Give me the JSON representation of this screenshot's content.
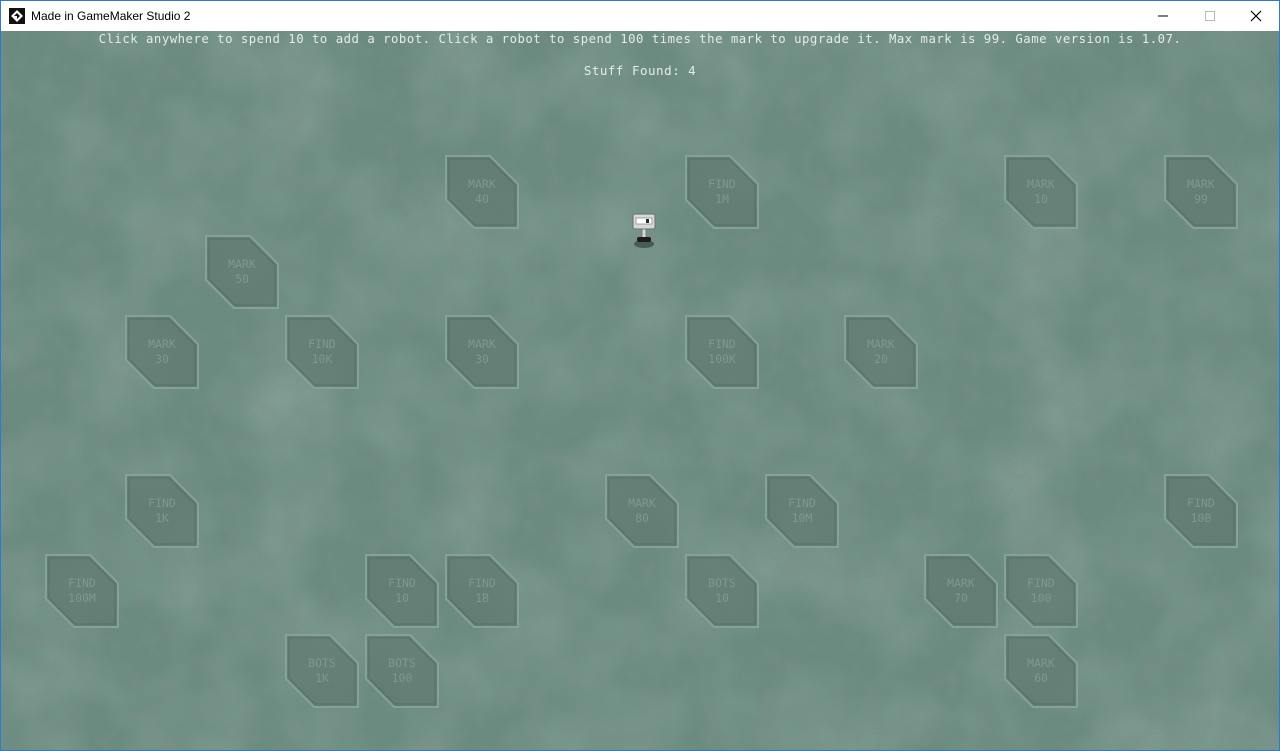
{
  "window": {
    "title": "Made in GameMaker Studio 2",
    "icon": "gamemaker-icon",
    "controls": [
      "minimize-icon",
      "maximize-icon",
      "close-icon"
    ]
  },
  "hud": {
    "instructions": "Click anywhere to spend 10 to add a robot. Click a robot to spend 100 times the mark to upgrade it. Max mark is 99. Game version is 1.07.",
    "stuff_found": "Stuff Found: 4"
  },
  "colors": {
    "ground": "#6b8c80",
    "hud_text": "#e4ece8",
    "tile_fill": "#5f7870",
    "tile_text": "#7e9890",
    "window_border": "#2b7bd1"
  },
  "tiles": [
    {
      "line1": "MARK",
      "line2": "40"
    },
    {
      "line1": "FIND",
      "line2": "1M"
    },
    {
      "line1": "MARK",
      "line2": "10"
    },
    {
      "line1": "MARK",
      "line2": "99"
    },
    {
      "line1": "MARK",
      "line2": "50"
    },
    {
      "line1": "MARK",
      "line2": "30"
    },
    {
      "line1": "FIND",
      "line2": "10K"
    },
    {
      "line1": "MARK",
      "line2": "30"
    },
    {
      "line1": "FIND",
      "line2": "100K"
    },
    {
      "line1": "MARK",
      "line2": "20"
    },
    {
      "line1": "FIND",
      "line2": "1K"
    },
    {
      "line1": "MARK",
      "line2": "80"
    },
    {
      "line1": "FIND",
      "line2": "10M"
    },
    {
      "line1": "FIND",
      "line2": "10B"
    },
    {
      "line1": "FIND",
      "line2": "100M"
    },
    {
      "line1": "FIND",
      "line2": "10"
    },
    {
      "line1": "FIND",
      "line2": "1B"
    },
    {
      "line1": "BOTS",
      "line2": "10"
    },
    {
      "line1": "MARK",
      "line2": "70"
    },
    {
      "line1": "FIND",
      "line2": "100"
    },
    {
      "line1": "BOTS",
      "line2": "1K"
    },
    {
      "line1": "BOTS",
      "line2": "100"
    },
    {
      "line1": "MARK",
      "line2": "60"
    }
  ],
  "robot": {
    "icon": "robot-icon"
  }
}
